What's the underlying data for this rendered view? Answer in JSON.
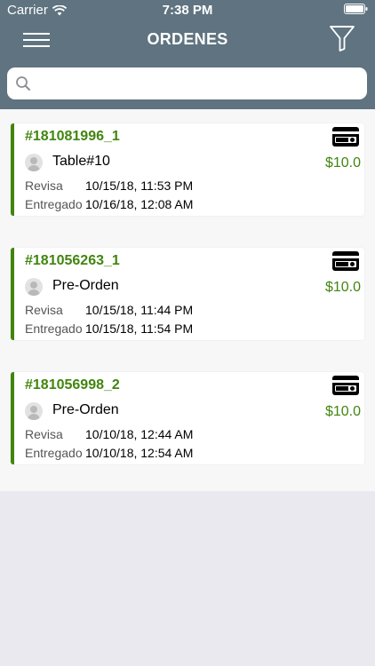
{
  "status": {
    "carrier": "Carrier",
    "time": "7:38 PM"
  },
  "nav": {
    "title": "ORDENES"
  },
  "search": {
    "placeholder": ""
  },
  "orders": [
    {
      "id": "#181081996_1",
      "table": "Table#10",
      "price": "$10.0",
      "revisa_label": "Revisa",
      "revisa": "10/15/18, 11:53 PM",
      "entregado_label": "Entregado",
      "entregado": "10/16/18, 12:08 AM"
    },
    {
      "id": "#181056263_1",
      "table": "Pre-Orden",
      "price": "$10.0",
      "revisa_label": "Revisa",
      "revisa": "10/15/18, 11:44 PM",
      "entregado_label": "Entregado",
      "entregado": "10/15/18, 11:54 PM"
    },
    {
      "id": "#181056998_2",
      "table": "Pre-Orden",
      "price": "$10.0",
      "revisa_label": "Revisa",
      "revisa": "10/10/18, 12:44 AM",
      "entregado_label": "Entregado",
      "entregado": "10/10/18, 12:54 AM"
    }
  ],
  "icons": {
    "wifi": "wifi-icon",
    "battery": "battery-icon",
    "menu": "hamburger-menu-icon",
    "filter": "filter-icon",
    "search": "search-icon",
    "payment": "credit-card-icon",
    "avatar": "user-avatar-icon"
  },
  "colors": {
    "header": "#5f7380",
    "accent": "#41850f",
    "background": "#e9e9ef"
  }
}
